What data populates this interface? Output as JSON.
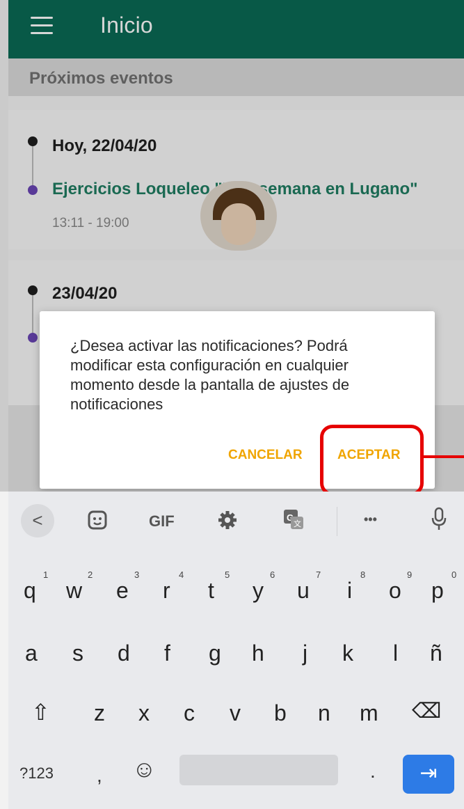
{
  "app_bar": {
    "title": "Inicio",
    "menu_icon": "hamburger-menu-icon"
  },
  "section": {
    "title": "Próximos eventos"
  },
  "events": [
    {
      "date": "Hoy, 22/04/20",
      "title": "Ejercicios Loqueleo \"Una semana en Lugano\"",
      "time": "13:11 - 19:00"
    },
    {
      "date": "23/04/20"
    }
  ],
  "dialog": {
    "message": "¿Desea activar las notificaciones? Podrá modificar esta configuración en cualquier momento desde la pantalla de ajustes de notificaciones",
    "cancel_label": "CANCELAR",
    "accept_label": "ACEPTAR"
  },
  "keyboard": {
    "toolbar": {
      "back": "<",
      "gif": "GIF",
      "more": "•••"
    },
    "row1": [
      "q",
      "w",
      "e",
      "r",
      "t",
      "y",
      "u",
      "i",
      "o",
      "p"
    ],
    "row1_hints": [
      "1",
      "2",
      "3",
      "4",
      "5",
      "6",
      "7",
      "8",
      "9",
      "0"
    ],
    "row2": [
      "a",
      "s",
      "d",
      "f",
      "g",
      "h",
      "j",
      "k",
      "l",
      "ñ"
    ],
    "row3": [
      "z",
      "x",
      "c",
      "v",
      "b",
      "n",
      "m"
    ],
    "shift_symbol": "⇧",
    "backspace_symbol": "⌫",
    "numbers_label": "?123",
    "comma": ",",
    "emoji_symbol": "☺",
    "period": ".",
    "enter_symbol": "⇥"
  },
  "colors": {
    "app_bar": "#0a6b55",
    "event_title": "#1f7e62",
    "dialog_button": "#f0a500",
    "highlight": "#e60000",
    "enter_key": "#2d7be6"
  }
}
